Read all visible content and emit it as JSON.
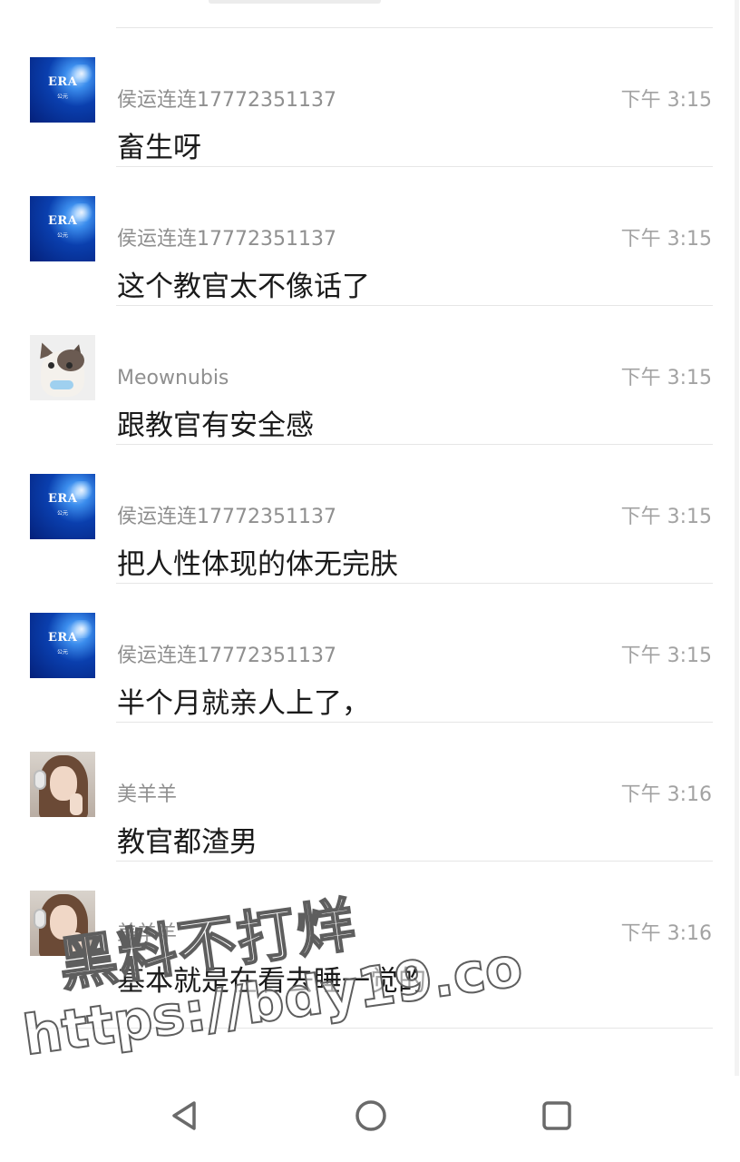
{
  "messages": [
    {
      "avatar": "era-logo-avatar",
      "avatar_text": "ERA",
      "avatar_subtext": "公元",
      "name": "侯运连连17772351137",
      "time": "下午 3:15",
      "text": "畜生呀"
    },
    {
      "avatar": "era-logo-avatar",
      "avatar_text": "ERA",
      "avatar_subtext": "公元",
      "name": "侯运连连17772351137",
      "time": "下午 3:15",
      "text": "这个教官太不像话了"
    },
    {
      "avatar": "cat-avatar",
      "name": "Meownubis",
      "time": "下午 3:15",
      "text": "跟教官有安全感"
    },
    {
      "avatar": "era-logo-avatar",
      "avatar_text": "ERA",
      "avatar_subtext": "公元",
      "name": "侯运连连17772351137",
      "time": "下午 3:15",
      "text": "把人性体现的体无完肤"
    },
    {
      "avatar": "era-logo-avatar",
      "avatar_text": "ERA",
      "avatar_subtext": "公元",
      "name": "侯运连连17772351137",
      "time": "下午 3:15",
      "text": "半个月就亲人上了，"
    },
    {
      "avatar": "girl-avatar",
      "name": "美羊羊",
      "time": "下午 3:16",
      "text": "教官都渣男"
    },
    {
      "avatar": "girl-avatar",
      "name": "美羊羊",
      "time": "下午 3:16",
      "text": "基本就是在看去睡一觉的"
    }
  ],
  "watermark": {
    "line1": "黑料不打烊",
    "line2": "https://bdy19.co"
  },
  "navigation": {
    "back": "back-triangle-icon",
    "home": "home-circle-icon",
    "recent": "recent-apps-square-icon"
  },
  "colors": {
    "name_text": "#8f8f8f",
    "time_text": "#a2a2a2",
    "message_text": "#1a1a1a",
    "separator": "#e6e6e6",
    "era_blue": "#0a3fae"
  }
}
